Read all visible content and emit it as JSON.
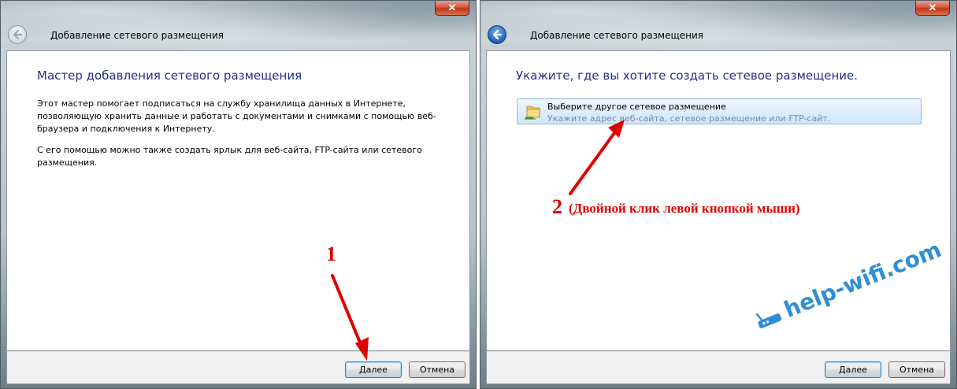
{
  "left_window": {
    "title": "Добавление сетевого размещения",
    "close_label": "✕",
    "heading": "Мастер добавления сетевого размещения",
    "paragraph1": "Этот мастер помогает подписаться на службу хранилища данных в Интернете, позволяющую хранить данные и работать с документами и снимками с помощью веб-браузера и подключения к Интернету.",
    "paragraph2": "С его помощью можно также создать ярлык для веб-сайта, FTP-сайта или сетевого размещения.",
    "next_label": "Далее",
    "cancel_label": "Отмена"
  },
  "right_window": {
    "title": "Добавление сетевого размещения",
    "close_label": "✕",
    "heading": "Укажите, где вы хотите создать сетевое размещение.",
    "option_title": "Выберите другое сетевое размещение",
    "option_desc": "Укажите адрес веб-сайта, сетевое размещение или FTP-сайт.",
    "next_label": "Далее",
    "cancel_label": "Отмена"
  },
  "annotations": {
    "step1": "1",
    "step2": "2",
    "step2_text": "(Двойной клик левой кнопкой мыши)",
    "color": "#e00000"
  },
  "watermark": "help-wifi.com",
  "colors": {
    "heading_blue": "#1e3287",
    "watermark_blue": "#2f8fd6"
  }
}
